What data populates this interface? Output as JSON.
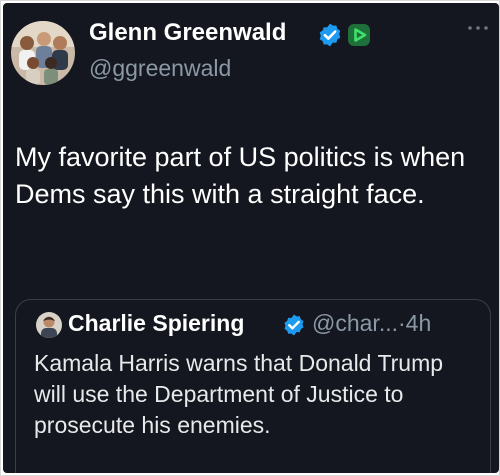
{
  "author": {
    "name": "Glenn Greenwald",
    "handle": "@ggreenwald"
  },
  "tweet": {
    "text": "My favorite part of US politics is when Dems say this with a straight face."
  },
  "quoted_tweet": {
    "author_name": "Charlie Spiering",
    "author_handle": "@char...",
    "separator": "·",
    "time": "4h",
    "text": "Kamala Harris warns that Donald Trump will use the Department of Justice to prosecute his enemies."
  },
  "icons": {
    "verified": "verified-check-icon",
    "media": "play-icon",
    "more": "more-horizontal-icon"
  },
  "colors": {
    "background": "#14171f",
    "verified_blue": "#1d9bf0",
    "play_green": "#2fbf4f",
    "secondary_text": "#8b98a5"
  }
}
